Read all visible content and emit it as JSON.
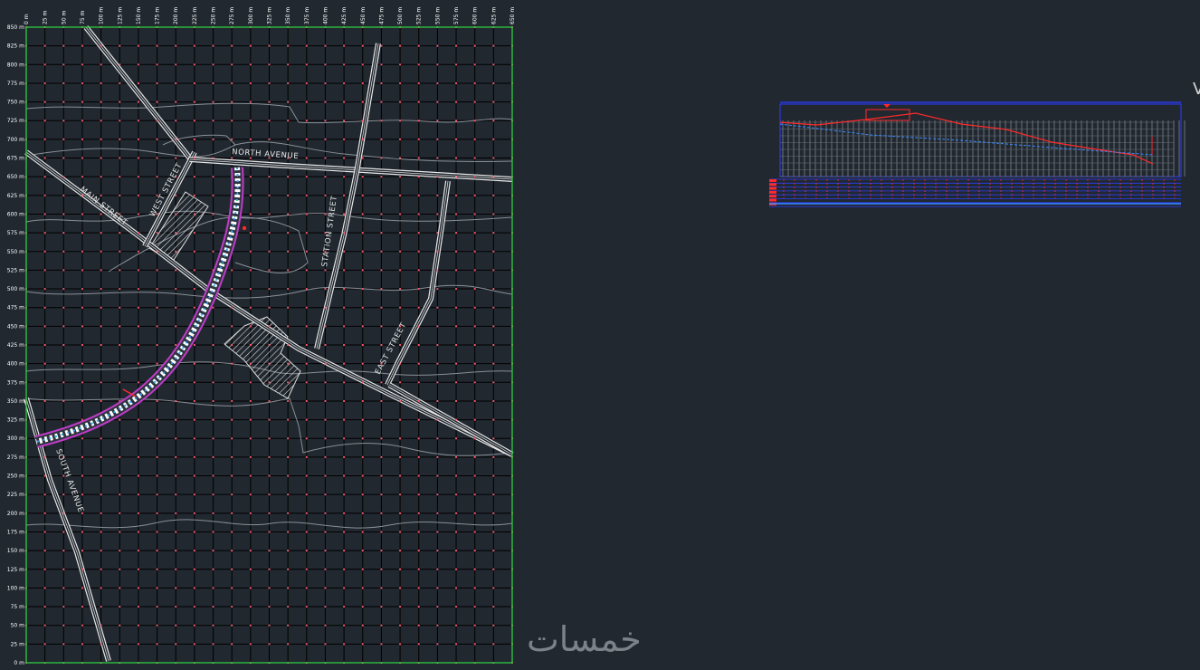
{
  "watermark": "خمسات",
  "edge_glyph": "V",
  "map": {
    "x_labels": [
      "0 m",
      "25 m",
      "50 m",
      "75 m",
      "100 m",
      "125 m",
      "150 m",
      "175 m",
      "200 m",
      "225 m",
      "250 m",
      "275 m",
      "300 m",
      "325 m",
      "350 m",
      "375 m",
      "400 m",
      "425 m",
      "450 m",
      "475 m",
      "500 m",
      "525 m",
      "550 m",
      "575 m",
      "600 m",
      "625 m",
      "650 m"
    ],
    "y_labels": [
      "850 m",
      "825 m",
      "800 m",
      "775 m",
      "750 m",
      "725 m",
      "700 m",
      "675 m",
      "650 m",
      "625 m",
      "600 m",
      "575 m",
      "550 m",
      "525 m",
      "500 m",
      "475 m",
      "450 m",
      "425 m",
      "400 m",
      "375 m",
      "350 m",
      "325 m",
      "300 m",
      "275 m",
      "250 m",
      "225 m",
      "200 m",
      "175 m",
      "150 m",
      "125 m",
      "100 m",
      "75 m",
      "50 m",
      "25 m",
      "0 m"
    ],
    "streets": {
      "north": "NORTH AVENUE",
      "main": "MAIN STREET",
      "west": "WEST STREET",
      "station": "STATION STREET",
      "east": "EAST STREET",
      "south": "SOUTH AVENUE"
    }
  },
  "colors": {
    "background": "#212830",
    "grid": "#000000",
    "border": "#2ecc40",
    "road": "#e8e8e8",
    "contour": "#8a8f96",
    "grid_node": "#ff5a6e",
    "alignment": "#c03cc8",
    "profile_ground": "#ff2a2a",
    "profile_frame": "#2a3cff"
  }
}
